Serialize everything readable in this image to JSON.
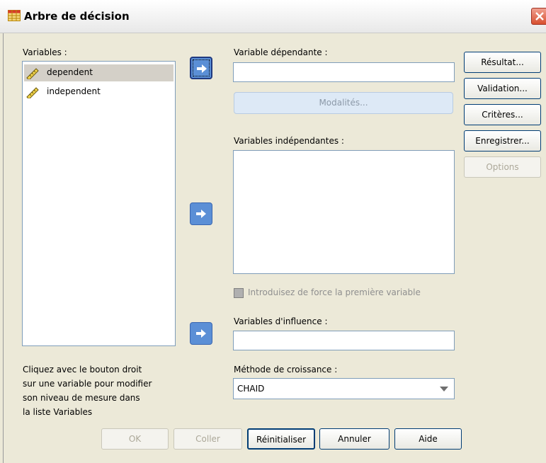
{
  "window": {
    "title": "Arbre de décision"
  },
  "variables": {
    "label": "Variables :",
    "items": [
      {
        "label": "dependent",
        "selected": true
      },
      {
        "label": "independent",
        "selected": false
      }
    ]
  },
  "dependent": {
    "label": "Variable dépendante :",
    "value": ""
  },
  "categories_button": "Modalités...",
  "independents": {
    "label": "Variables indépendantes :"
  },
  "force_first": {
    "label": "Introduisez de force la première variable"
  },
  "influence": {
    "label": "Variables d'influence :",
    "value": ""
  },
  "growth": {
    "label": "Méthode de croissance :",
    "selected": "CHAID"
  },
  "help_text": [
    "Cliquez avec le bouton droit",
    "sur une variable pour modifier",
    "son niveau de mesure dans",
    "la liste Variables"
  ],
  "side_buttons": {
    "output": "Résultat...",
    "validation": "Validation...",
    "criteria": "Critères...",
    "save": "Enregistrer...",
    "options": "Options"
  },
  "bottom_buttons": {
    "ok": "OK",
    "paste": "Coller",
    "reset": "Réinitialiser",
    "cancel": "Annuler",
    "help": "Aide"
  },
  "colors": {
    "accent": "#5b8fd6",
    "dialog_bg": "#ece9d8",
    "selection": "#d4d0c8"
  }
}
